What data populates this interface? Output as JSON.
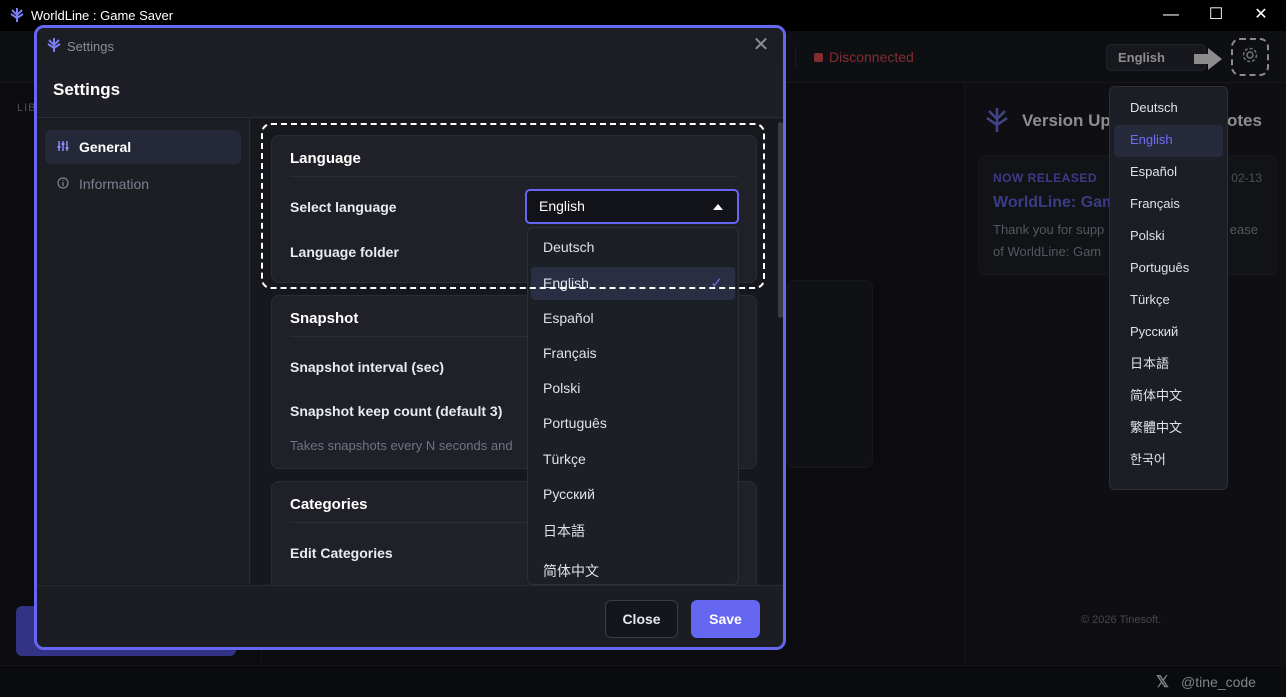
{
  "window": {
    "title": "WorldLine : Game Saver",
    "minimize": "—",
    "maximize": "☐",
    "close": "✕"
  },
  "header": {
    "status": "Disconnected",
    "language_button": "English"
  },
  "language_menu": {
    "items": [
      "Deutsch",
      "English",
      "Español",
      "Français",
      "Polski",
      "Português",
      "Türkçe",
      "Русский",
      "日本語",
      "简体中文",
      "繁體中文",
      "한국어"
    ],
    "selected": "English"
  },
  "left_panel": {
    "label": "LIB"
  },
  "version_panel": {
    "title_left": "Version Upd",
    "title_right": "otes",
    "badge": "NOW RELEASED",
    "date": "02-13",
    "release_title": "WorldLine: Gam",
    "description_line1": "Thank you for supp",
    "description_line1_end": "ease",
    "description_line2": "of WorldLine: Gam",
    "copyright": "© 2026 Tinesoft."
  },
  "footer": {
    "handle": "@tine_code",
    "x_icon": "𝕏"
  },
  "dialog": {
    "window_title": "Settings",
    "heading": "Settings",
    "close_glyph": "✕",
    "nav": {
      "general": "General",
      "information": "Information"
    },
    "language_card": {
      "title": "Language",
      "select_label": "Select language",
      "select_value": "English",
      "folder_label": "Language folder"
    },
    "snapshot_card": {
      "title": "Snapshot",
      "interval_label": "Snapshot interval (sec)",
      "keep_label": "Snapshot keep count (default 3)",
      "hint": "Takes snapshots every N seconds and"
    },
    "categories_card": {
      "title": "Categories",
      "edit_label": "Edit Categories"
    },
    "dropdown": {
      "options": [
        "Deutsch",
        "English",
        "Español",
        "Français",
        "Polski",
        "Português",
        "Türkçe",
        "Русский",
        "日本語",
        "简体中文"
      ],
      "selected": "English",
      "check": "✓"
    },
    "buttons": {
      "close": "Close",
      "save": "Save"
    }
  },
  "colors": {
    "accent": "#6567f2",
    "status_error": "#f0515b",
    "background": "#16171d"
  }
}
